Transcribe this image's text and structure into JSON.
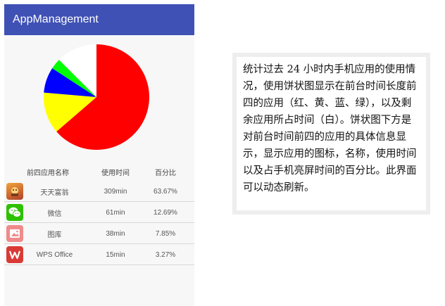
{
  "app": {
    "title": "AppManagement",
    "bar_color": "#3f51b5"
  },
  "chart_data": {
    "type": "pie",
    "title": "",
    "slices": [
      {
        "label": "天天富翁",
        "value": 63.67,
        "color": "#ff0000"
      },
      {
        "label": "微信",
        "value": 12.69,
        "color": "#ffff00"
      },
      {
        "label": "图库",
        "value": 7.85,
        "color": "#0000ff"
      },
      {
        "label": "WPS Office",
        "value": 3.27,
        "color": "#00ff00"
      },
      {
        "label": "其他",
        "value": 12.52,
        "color": "#ffffff"
      }
    ]
  },
  "table": {
    "headers": [
      "前四应用名称",
      "使用时间",
      "百分比"
    ],
    "rows": [
      {
        "name": "天天富翁",
        "time": "309min",
        "percent": "63.67%",
        "icon": "tiantian-fuweng-icon"
      },
      {
        "name": "微信",
        "time": "61min",
        "percent": "12.69%",
        "icon": "wechat-icon"
      },
      {
        "name": "图库",
        "time": "38min",
        "percent": "7.85%",
        "icon": "gallery-icon"
      },
      {
        "name": "WPS Office",
        "time": "15min",
        "percent": "3.27%",
        "icon": "wps-office-icon"
      }
    ]
  },
  "description": "统计过去 24 小时内手机应用的使用情况，使用饼状图显示在前台时间长度前四的应用（红、黄、蓝、绿），以及剩余应用所占时间（白）。饼状图下方是对前台时间前四的应用的具体信息显示，显示应用的图标，名称，使用时间以及占手机亮屏时间的百分比。此界面可以动态刷新。"
}
